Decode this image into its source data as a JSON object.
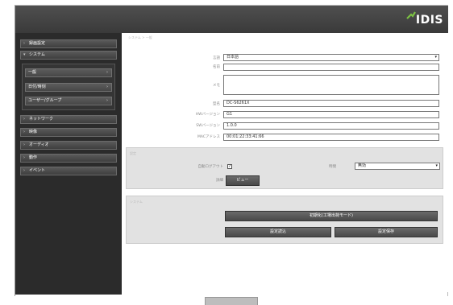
{
  "header": {
    "logo_text": "IDIS"
  },
  "sidebar": {
    "items": [
      {
        "label": "録画設定"
      },
      {
        "label": "システム"
      },
      {
        "label": "ネットワーク"
      },
      {
        "label": "映像"
      },
      {
        "label": "オーディオ"
      },
      {
        "label": "動作"
      },
      {
        "label": "イベント"
      }
    ],
    "sub_items": [
      {
        "label": "一般"
      },
      {
        "label": "日付/時刻"
      },
      {
        "label": "ユーザー/グループ"
      }
    ]
  },
  "main": {
    "breadcrumb": "システム > 一般",
    "form": {
      "language_label": "言語",
      "language_value": "日本語",
      "name_label": "名前",
      "note_label": "メモ",
      "model_label": "型名",
      "model_value": "DC-S6261X",
      "hw_label": "HWバージョン",
      "hw_value": "G1",
      "sw_label": "SWバージョン",
      "sw_value": "1.0.0",
      "mac_label": "MACアドレス",
      "mac_value": "00:01:22:33:41:66"
    },
    "setup_panel": {
      "label": "設定",
      "auto_label": "自動ログアウト",
      "check_mark": "✓",
      "interval_label": "時間",
      "interval_value": "無効",
      "show_label": "詳細",
      "show_button": "ビュー"
    },
    "system_panel": {
      "label": "システム",
      "factory_reset": "初期化(工場出荷モード)",
      "load_setup": "設定読込",
      "save_setup": "設定保存"
    }
  },
  "colors": {
    "topbar": "#3f3f3f",
    "sidebar": "#2b2b2b",
    "button": "#555555",
    "panel": "#e2e2e2"
  }
}
